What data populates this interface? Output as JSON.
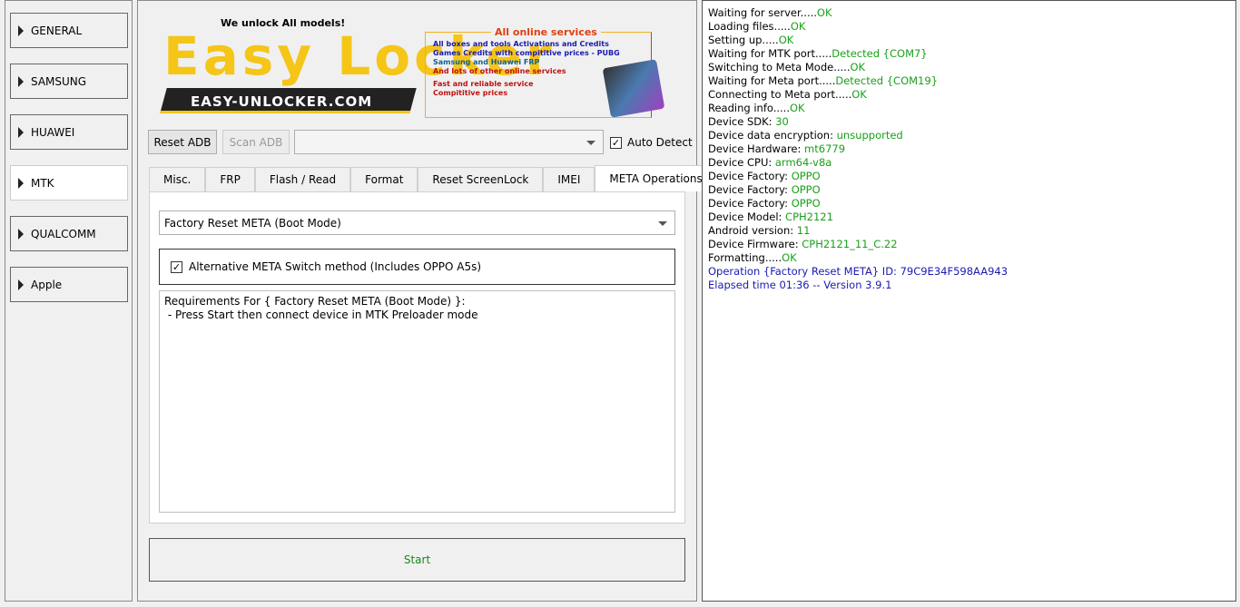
{
  "sidebar": {
    "items": [
      {
        "label": "GENERAL"
      },
      {
        "label": "SAMSUNG"
      },
      {
        "label": "HUAWEI"
      },
      {
        "label": "MTK",
        "active": true
      },
      {
        "label": "QUALCOMM"
      },
      {
        "label": "Apple"
      }
    ]
  },
  "banner": {
    "tagline": "We unlock All models!",
    "logo": "Easy Locker",
    "site": "EASY-UNLOCKER.COM",
    "services_title": "All online services",
    "services": [
      "All boxes and tools Activations and Credits",
      "Games Credits with compititive prices - PUBG",
      "Samsung and Huawei FRP",
      "And lots of other online services"
    ],
    "promo": [
      "Fast and reliable service",
      "Compititive prices"
    ]
  },
  "toolbar": {
    "reset_adb": "Reset ADB",
    "scan_adb": "Scan ADB",
    "port_value": "",
    "auto_detect": "Auto Detect",
    "auto_detect_checked": true
  },
  "tabs": [
    {
      "label": "Misc."
    },
    {
      "label": "FRP"
    },
    {
      "label": "Flash / Read"
    },
    {
      "label": "Format"
    },
    {
      "label": "Reset ScreenLock"
    },
    {
      "label": "IMEI"
    },
    {
      "label": "META Operations",
      "active": true
    }
  ],
  "meta": {
    "operation": "Factory Reset META (Boot Mode)",
    "alt_switch": "Alternative META Switch method (Includes OPPO A5s)",
    "alt_switch_checked": true,
    "requirements": "Requirements For { Factory Reset META (Boot Mode) }:\n - Press Start then connect device in MTK Preloader mode"
  },
  "start_label": "Start",
  "colors": {
    "ok": "#1aa01a",
    "info": "#1a1ab0",
    "start_text": "#1a8a1a"
  },
  "log": [
    [
      "Waiting for server.....",
      "OK"
    ],
    [
      "Loading files.....",
      "OK"
    ],
    [
      "Setting up.....",
      "OK"
    ],
    [
      "Waiting for MTK port.....",
      "Detected {COM7}"
    ],
    [
      "Switching to Meta Mode.....",
      "OK"
    ],
    [
      "Waiting for Meta port.....",
      "Detected {COM19}"
    ],
    [
      "Connecting to Meta port.....",
      "OK"
    ],
    [
      "Reading info.....",
      "OK"
    ],
    [
      "Device SDK: ",
      "30"
    ],
    [
      "Device data encryption: ",
      "unsupported"
    ],
    [
      "Device Hardware: ",
      "mt6779"
    ],
    [
      "Device CPU: ",
      "arm64-v8a"
    ],
    [
      "Device Factory: ",
      "OPPO"
    ],
    [
      "Device Factory: ",
      "OPPO"
    ],
    [
      "Device Factory: ",
      "OPPO"
    ],
    [
      "Device Model: ",
      "CPH2121"
    ],
    [
      "Android version: ",
      "11"
    ],
    [
      "Device Firmware: ",
      "CPH2121_11_C.22"
    ],
    [
      "Formatting.....",
      "OK"
    ]
  ],
  "log_info": [
    "Operation {Factory Reset META} ID: 79C9E34F598AA943",
    "Elapsed time 01:36 -- Version 3.9.1"
  ]
}
